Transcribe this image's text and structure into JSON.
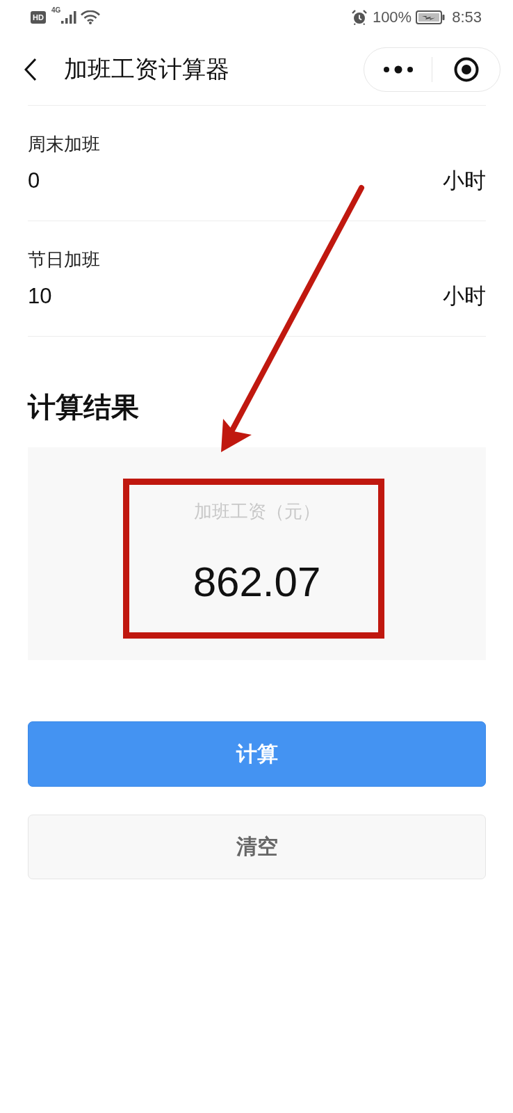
{
  "status_bar": {
    "hd_badge": "HD",
    "network_type": "4G",
    "battery": "100%",
    "time": "8:53"
  },
  "nav_bar": {
    "title": "加班工资计算器"
  },
  "fields": [
    {
      "label": "周末加班",
      "value": "0",
      "unit": "小时"
    },
    {
      "label": "节日加班",
      "value": "10",
      "unit": "小时"
    }
  ],
  "result": {
    "heading": "计算结果",
    "label": "加班工资（元）",
    "value": "862.07"
  },
  "buttons": [
    {
      "label": "计算",
      "kind": "primary"
    },
    {
      "label": "清空",
      "kind": "secondary"
    }
  ]
}
